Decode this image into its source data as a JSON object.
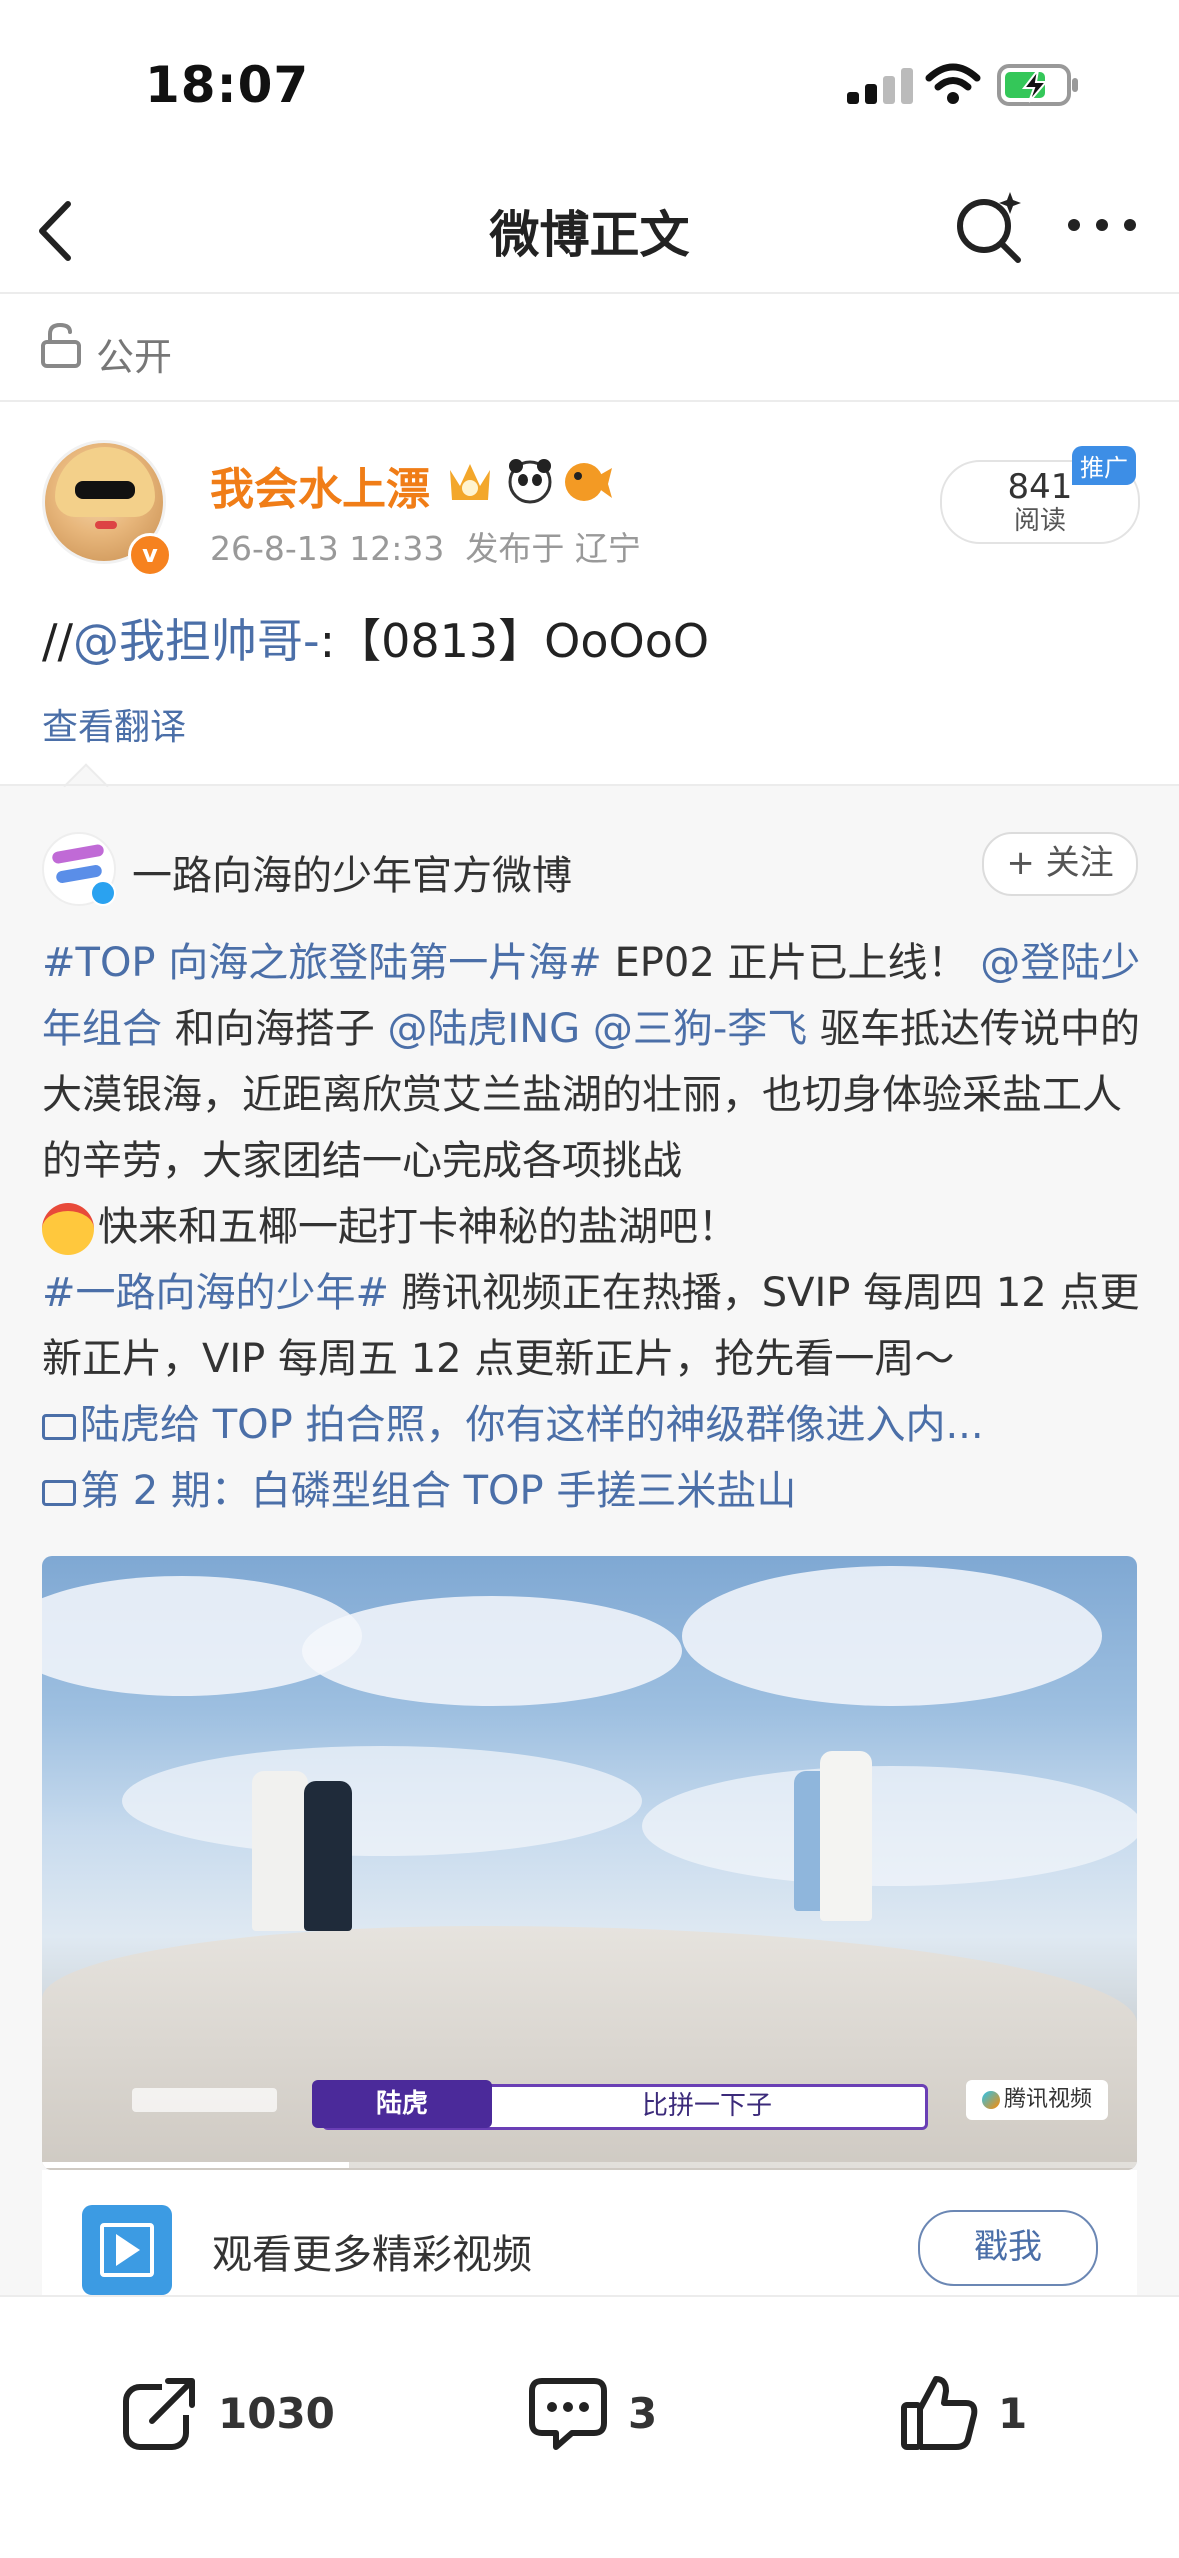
{
  "status_bar": {
    "time": "18:07"
  },
  "nav": {
    "title": "微博正文"
  },
  "visibility": {
    "label": "公开"
  },
  "post": {
    "username": "我会水上漂",
    "time": "26-8-13 12:33",
    "location": "发布于 辽宁",
    "read_count": "841",
    "read_label": "阅读",
    "promo_tag": "推广",
    "text_prefix": "//",
    "mention": "@我担帅哥-",
    "text_suffix": ":【0813】OoOoO",
    "translate": "查看翻译"
  },
  "repost": {
    "author": "一路向海的少年官方微博",
    "follow_label": "+ 关注",
    "line1_tag": "#TOP 向海之旅登陆第一片海#",
    "line1_text": " EP02 正片已上线！",
    "line1_mention": "@登陆少年组合",
    "line2_text": " 和向海搭子 ",
    "line2_mention1": "@陆虎ING",
    "line2_mention2": "@三狗-李飞",
    "line2_text2": " 驱车抵达传说中的大漠银海，近距离欣赏艾兰盐湖的壮丽，也切身体验采盐工人的辛劳，大家团结一心完成各项挑战",
    "line3_text": "快来和五椰一起打卡神秘的盐湖吧！",
    "line4_tag": "#一路向海的少年#",
    "line4_text": " 腾讯视频正在热播，SVIP 每周四 12 点更新正片，VIP 每周五 12 点更新正片，抢先看一周～",
    "link1": "陆虎给 TOP 拍合照，你有这样的神级群像进入内...",
    "link2": "第 2 期：白磷型组合 TOP 手搓三米盐山",
    "video": {
      "caption_name": "陆虎",
      "caption_text": "比拼一下子",
      "platform": "腾讯视频",
      "progress": 0.28
    },
    "more_video": {
      "label": "观看更多精彩视频",
      "button": "戳我"
    }
  },
  "actions": {
    "repost_count": "1030",
    "comment_count": "3",
    "like_count": "1"
  },
  "colors": {
    "link": "#4b6fa8",
    "username": "#f07d17",
    "accent_blue": "#3c9be3"
  }
}
